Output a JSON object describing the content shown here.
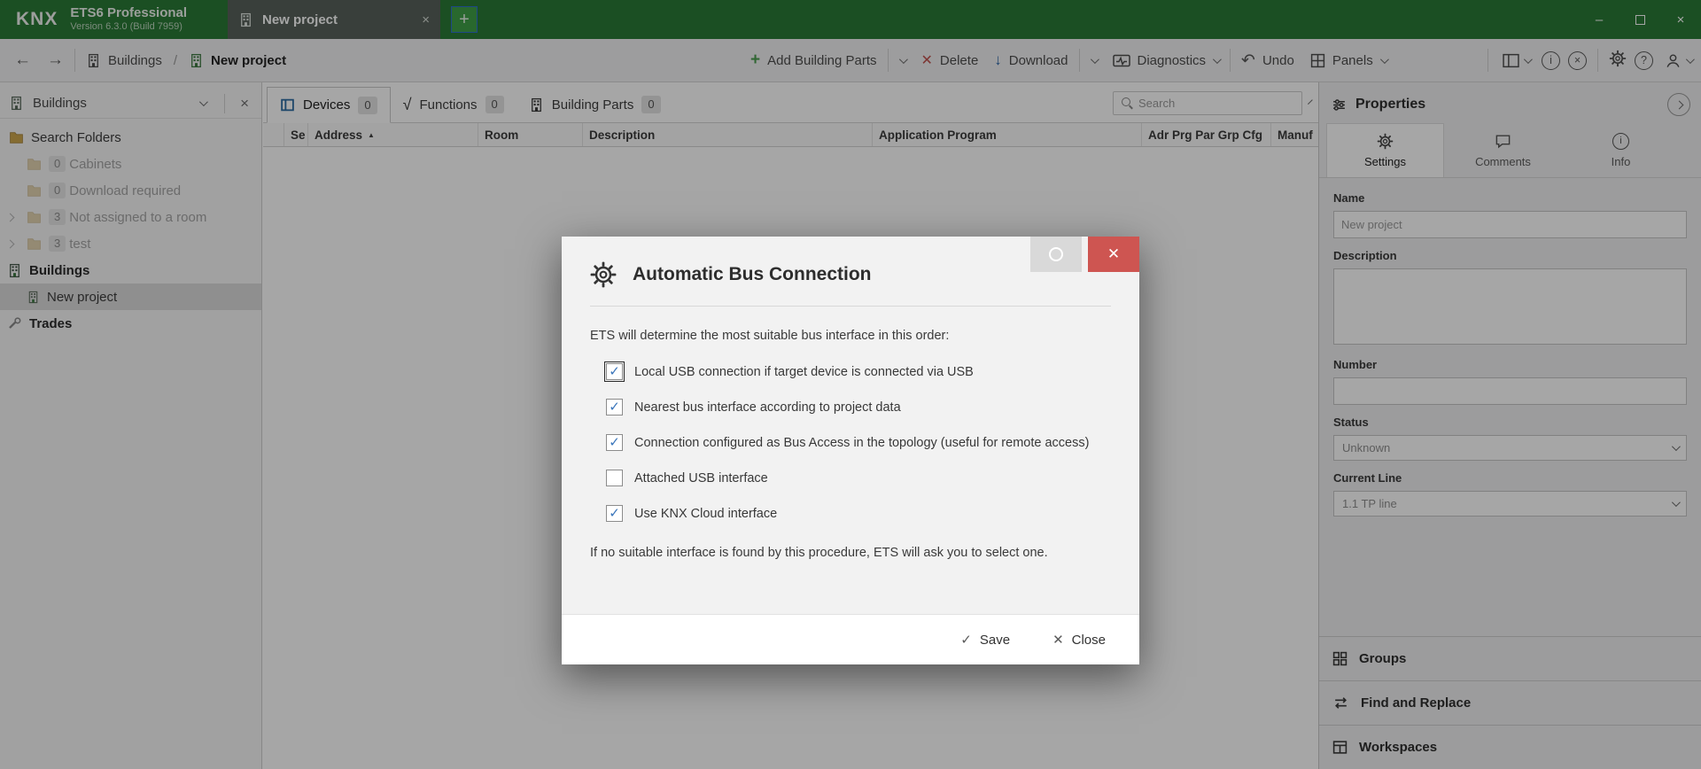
{
  "titlebar": {
    "logo": "KNX",
    "app_name": "ETS6 Professional",
    "app_version": "Version 6.3.0 (Build 7959)",
    "project_tab_label": "New project",
    "tab_close_glyph": "×",
    "new_tab_glyph": "+",
    "minimize_glyph": "–",
    "close_glyph": "×"
  },
  "toolbar": {
    "breadcrumb_root": "Buildings",
    "breadcrumb_separator": "/",
    "breadcrumb_current": "New project",
    "add_building_parts_label": "Add Building Parts",
    "delete_label": "Delete",
    "download_label": "Download",
    "diagnostics_label": "Diagnostics",
    "undo_label": "Undo",
    "panels_label": "Panels",
    "glyphs": {
      "back": "←",
      "forward": "→",
      "add": "+",
      "delete": "✕",
      "download": "↓",
      "undo": "↶",
      "info": "i",
      "help": "?",
      "cancel": "×"
    }
  },
  "sidebar": {
    "header_label": "Buildings",
    "close_glyph": "×",
    "items": [
      {
        "label": "Search Folders"
      },
      {
        "label": "Cabinets",
        "badge": "0"
      },
      {
        "label": "Download required",
        "badge": "0"
      },
      {
        "label": "Not assigned to a room",
        "badge": "3"
      },
      {
        "label": "test",
        "badge": "3"
      },
      {
        "label": "Buildings"
      },
      {
        "label": "New project"
      },
      {
        "label": "Trades"
      }
    ]
  },
  "main": {
    "close_panel_glyph": "×",
    "tabs": [
      {
        "label": "Devices",
        "count": "0"
      },
      {
        "label": "Functions",
        "count": "0",
        "glyph": "√"
      },
      {
        "label": "Building Parts",
        "count": "0"
      }
    ],
    "search_placeholder": "Search",
    "sort_glyph": "▲",
    "columns": [
      "Se",
      "Address",
      "Room",
      "Description",
      "Application Program",
      "Adr Prg Par Grp Cfg",
      "Manuf"
    ]
  },
  "properties": {
    "title": "Properties",
    "tabs": [
      {
        "label": "Settings"
      },
      {
        "label": "Comments"
      },
      {
        "label": "Info"
      }
    ],
    "name_label": "Name",
    "name_value": "New project",
    "description_label": "Description",
    "number_label": "Number",
    "status_label": "Status",
    "status_value": "Unknown",
    "current_line_label": "Current Line",
    "current_line_value": "1.1 TP line",
    "bottom_items": [
      {
        "label": "Groups"
      },
      {
        "label": "Find and Replace"
      },
      {
        "label": "Workspaces"
      }
    ]
  },
  "dialog": {
    "title": "Automatic Bus Connection",
    "intro": "ETS will determine the most suitable bus interface in this order:",
    "options": [
      {
        "label": "Local USB connection if target device is connected via USB",
        "checked": true,
        "focused": true
      },
      {
        "label": "Nearest bus interface according to project data",
        "checked": true
      },
      {
        "label": "Connection configured as Bus Access in the topology (useful for remote access)",
        "checked": true
      },
      {
        "label": "Attached USB interface",
        "checked": false
      },
      {
        "label": "Use KNX Cloud interface",
        "checked": true
      }
    ],
    "note": "If no suitable interface is found by this procedure, ETS will ask you to select one.",
    "save_label": "Save",
    "close_label": "Close",
    "check_glyph": "✓",
    "close_glyph": "✕"
  },
  "colors": {
    "titlebar_green": "#2a7a36",
    "accent_blue": "#3b76bb",
    "danger_red": "#ce5551",
    "dim_overlay": "rgba(0,0,0,0.35)"
  }
}
